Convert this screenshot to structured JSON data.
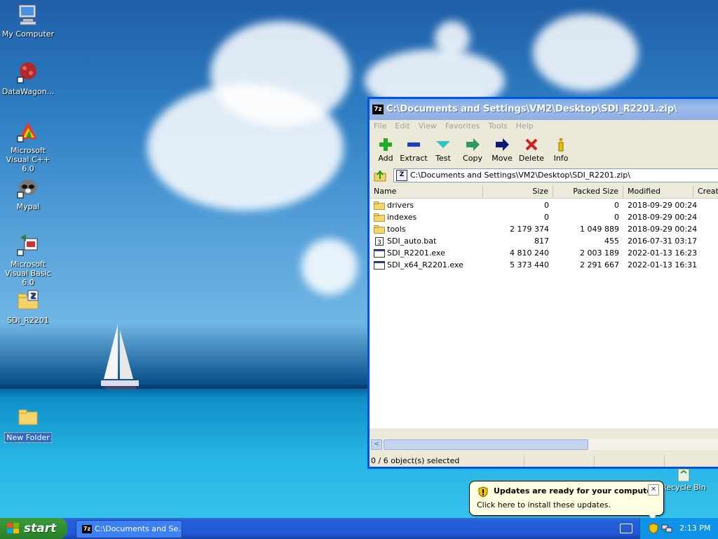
{
  "desktop": {
    "icons": [
      {
        "label": "My Computer"
      },
      {
        "label": "DataWagon..."
      },
      {
        "label": "Microsoft Visual C++ 6.0"
      },
      {
        "label": "Mypal"
      },
      {
        "label": "Microsoft Visual Basic 6.0"
      },
      {
        "label": "SDI_R2201"
      },
      {
        "label": "New Folder"
      },
      {
        "label": "Recycle Bin"
      }
    ]
  },
  "window": {
    "title": "C:\\Documents and Settings\\VM2\\Desktop\\SDI_R2201.zip\\",
    "app_icon": "7z",
    "menu": [
      "File",
      "Edit",
      "View",
      "Favorites",
      "Tools",
      "Help"
    ],
    "toolbar": [
      "Add",
      "Extract",
      "Test",
      "Copy",
      "Move",
      "Delete",
      "Info"
    ],
    "address": "C:\\Documents and Settings\\VM2\\Desktop\\SDI_R2201.zip\\",
    "columns": [
      "Name",
      "Size",
      "Packed Size",
      "Modified",
      "Creat"
    ],
    "rows": [
      {
        "name": "drivers",
        "size": "0",
        "packed": "0",
        "modified": "2018-09-29 00:24",
        "type": "folder"
      },
      {
        "name": "indexes",
        "size": "0",
        "packed": "0",
        "modified": "2018-09-29 00:24",
        "type": "folder"
      },
      {
        "name": "tools",
        "size": "2 179 374",
        "packed": "1 049 889",
        "modified": "2018-09-29 00:24",
        "type": "folder"
      },
      {
        "name": "SDI_auto.bat",
        "size": "817",
        "packed": "455",
        "modified": "2016-07-31 03:17",
        "type": "bat"
      },
      {
        "name": "SDI_R2201.exe",
        "size": "4 810 240",
        "packed": "2 003 189",
        "modified": "2022-01-13 16:23",
        "type": "exe"
      },
      {
        "name": "SDI_x64_R2201.exe",
        "size": "5 373 440",
        "packed": "2 291 667",
        "modified": "2022-01-13 16:31",
        "type": "exe"
      }
    ],
    "status": "0 / 6 object(s) selected"
  },
  "balloon": {
    "title": "Updates are ready for your computer",
    "body": "Click here to install these updates."
  },
  "taskbar": {
    "start_label": "start",
    "task_button": "C:\\Documents and Se...",
    "clock": "2:13 PM"
  },
  "colors": {
    "accent": "#0054e3",
    "taskbar": "#245edb",
    "start": "#2f8f2f"
  }
}
